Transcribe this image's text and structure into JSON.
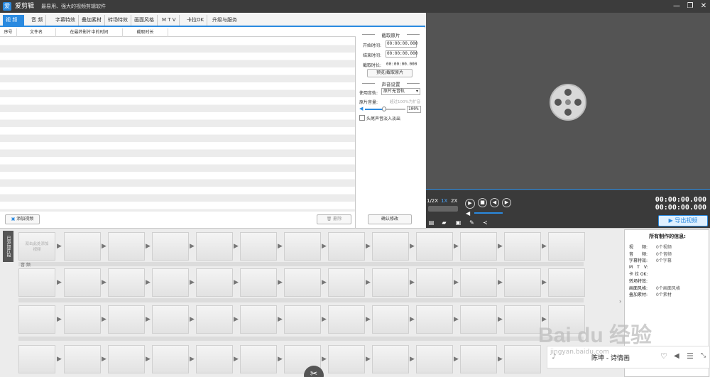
{
  "titlebar": {
    "logo": "爱",
    "title": "爱剪辑",
    "slogan": "最易用、强大的视频剪辑软件",
    "min": "—",
    "restore": "❐",
    "close": "✕"
  },
  "tabs": [
    "视 频",
    "音 频",
    "字幕特效",
    "叠加素材",
    "转场特效",
    "画面风格",
    "M T V",
    "卡拉OK",
    "升级与服务"
  ],
  "table": {
    "headers": [
      "序号",
      "文件名",
      "在最终影片中的时间",
      "截取时长"
    ]
  },
  "list_footer": {
    "add_video": "添加视频",
    "delete": "删除"
  },
  "clip_settings": {
    "section_title": "截取原片",
    "start_label": "开始时间:",
    "start_value": "00:00:00.000",
    "end_label": "结束时间:",
    "end_value": "00:00:00.000",
    "duration_label": "截取时长:",
    "duration_value": "00:00:00.000",
    "preview_button": "预览/截取原片",
    "audio_section": "声音设置",
    "track_label": "使用音轨:",
    "track_value": "原片无音轨",
    "volume_label": "原片音量:",
    "volume_hint": "超过100%为扩音",
    "volume_value": "100%",
    "fade_label": "头尾声音淡入淡出",
    "confirm": "确认修改"
  },
  "player": {
    "speeds": [
      "1/2X",
      "1X",
      "2X"
    ],
    "time_current": "00:00:00.000",
    "time_total": "00:00:00.000",
    "export": "导出视频"
  },
  "side_label": "已添加片段",
  "timeline": {
    "first_clip_text": "双击此处添加视频",
    "audio_label": "音 频"
  },
  "info": {
    "title": "所有制作的信息:",
    "rows": [
      {
        "k": "视　　频:",
        "v": "0个视频"
      },
      {
        "k": "音　　频:",
        "v": "0个音频"
      },
      {
        "k": "字幕特效:",
        "v": "0个字幕"
      },
      {
        "k": "M　T　V:",
        "v": ""
      },
      {
        "k": "卡 拉 OK:",
        "v": ""
      },
      {
        "k": "转场特效:",
        "v": ""
      },
      {
        "k": "画面风格:",
        "v": "0个画面风格"
      },
      {
        "k": "叠加素材:",
        "v": "0个素材"
      }
    ]
  },
  "music_popup": {
    "text": "陈坤 - 诗情画"
  },
  "watermark": {
    "text": "Bai du 经验",
    "url": "jingyan.baidu.com"
  }
}
